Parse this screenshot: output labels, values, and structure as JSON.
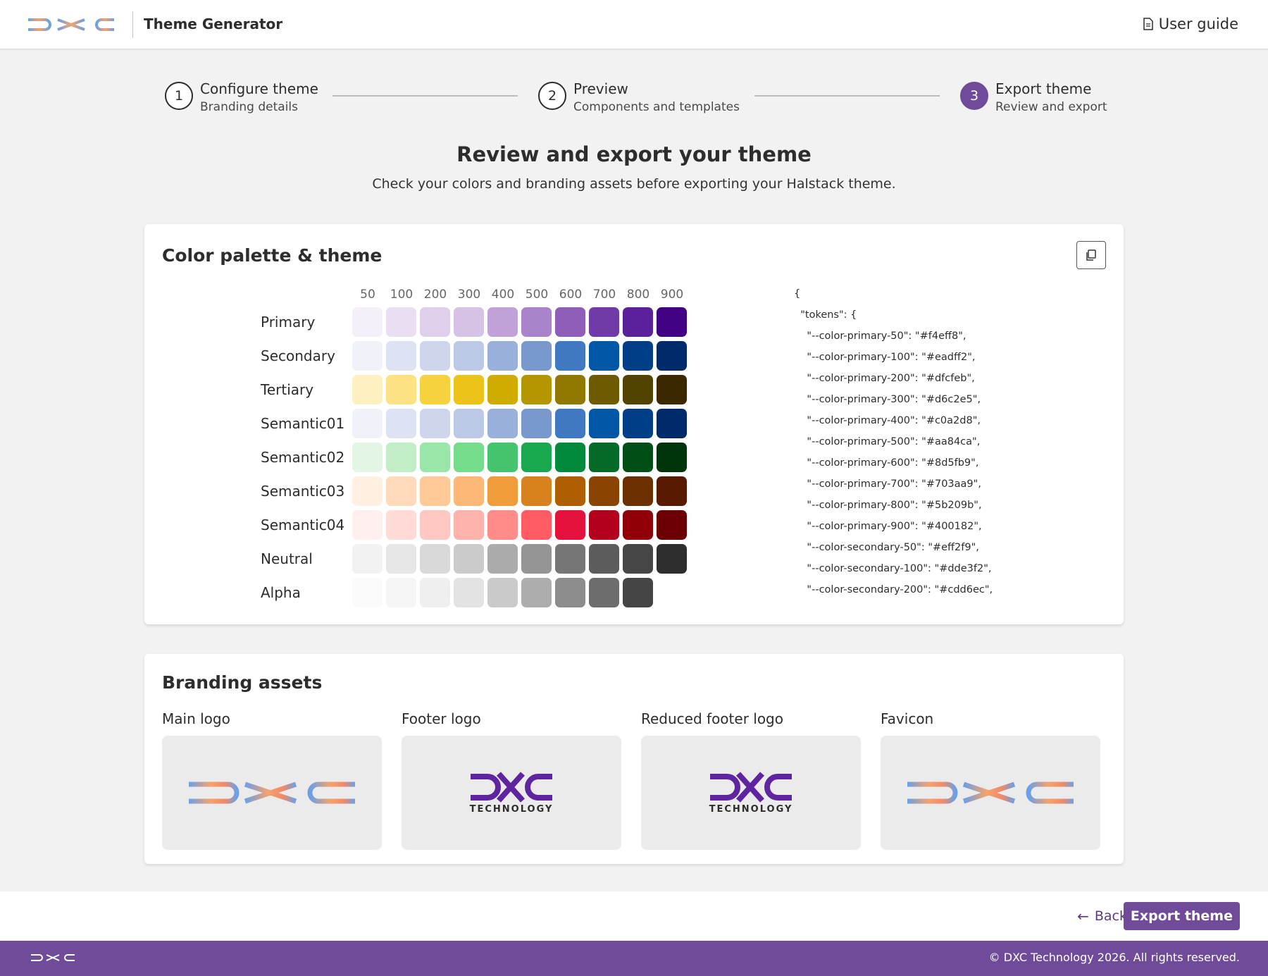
{
  "header": {
    "app_title": "Theme Generator",
    "user_guide_label": "User guide"
  },
  "stepper": [
    {
      "number": "1",
      "title": "Configure theme",
      "subtitle": "Branding details",
      "state": "done"
    },
    {
      "number": "2",
      "title": "Preview",
      "subtitle": "Components and templates",
      "state": "done"
    },
    {
      "number": "3",
      "title": "Export theme",
      "subtitle": "Review and export",
      "state": "active"
    }
  ],
  "page": {
    "title": "Review and export your theme",
    "subtitle": "Check your colors and branding assets before exporting your Halstack theme."
  },
  "palette_card": {
    "title": "Color palette & theme",
    "shades": [
      "50",
      "100",
      "200",
      "300",
      "400",
      "500",
      "600",
      "700",
      "800",
      "900"
    ],
    "rows": [
      {
        "label": "Primary",
        "colors": [
          "#f4eff8",
          "#eadff2",
          "#dfcfeb",
          "#d6c2e5",
          "#c0a2d8",
          "#aa84ca",
          "#8d5fb9",
          "#703aa9",
          "#5b209b",
          "#400182"
        ]
      },
      {
        "label": "Secondary",
        "colors": [
          "#eff2f9",
          "#dde3f2",
          "#cdd6ec",
          "#bbc9e6",
          "#99b0db",
          "#7998cc",
          "#3f79c1",
          "#0057a5",
          "#003f88",
          "#012a6b"
        ]
      },
      {
        "label": "Tertiary",
        "colors": [
          "#fff0c2",
          "#fde283",
          "#f7d23f",
          "#ecc419",
          "#d1ac00",
          "#b59500",
          "#917800",
          "#6e5a00",
          "#534300",
          "#3b2800"
        ]
      },
      {
        "label": "Semantic01",
        "colors": [
          "#eff2f9",
          "#dde3f2",
          "#cdd6ec",
          "#bbc9e6",
          "#99b0db",
          "#7998cc",
          "#3f79c1",
          "#0057a5",
          "#003f88",
          "#012a6b"
        ]
      },
      {
        "label": "Semantic02",
        "colors": [
          "#e3f5e5",
          "#c1edc7",
          "#9ae6a8",
          "#75dc8c",
          "#44c46d",
          "#19a84f",
          "#018a3b",
          "#036b27",
          "#004f17",
          "#00350c"
        ]
      },
      {
        "label": "Semantic03",
        "colors": [
          "#fff0e2",
          "#ffdbbb",
          "#ffca97",
          "#fdb878",
          "#f19c3a",
          "#d8821f",
          "#b05f00",
          "#8a4400",
          "#6c3000",
          "#581a00"
        ]
      },
      {
        "label": "Semantic04",
        "colors": [
          "#fff0ef",
          "#ffdad7",
          "#ffc8c3",
          "#ffb1ab",
          "#ff8c88",
          "#ff5c63",
          "#e5113d",
          "#b3001d",
          "#8f0009",
          "#6b0004"
        ]
      },
      {
        "label": "Neutral",
        "colors": [
          "#f2f2f2",
          "#e6e6e6",
          "#d9d9d9",
          "#cbcbcb",
          "#ababab",
          "#959595",
          "#767676",
          "#5c5c5c",
          "#464646",
          "#2e2e2e"
        ]
      },
      {
        "label": "Alpha",
        "colors": [
          "#fafafa",
          "#f5f5f5",
          "#efefef",
          "#e3e3e3",
          "#cacaca",
          "#adadad",
          "#8c8c8c",
          "#6d6d6d",
          "#454545"
        ]
      }
    ],
    "json_lines": [
      "{",
      "  \"tokens\": {",
      "    \"--color-primary-50\": \"#f4eff8\",",
      "    \"--color-primary-100\": \"#eadff2\",",
      "    \"--color-primary-200\": \"#dfcfeb\",",
      "    \"--color-primary-300\": \"#d6c2e5\",",
      "    \"--color-primary-400\": \"#c0a2d8\",",
      "    \"--color-primary-500\": \"#aa84ca\",",
      "    \"--color-primary-600\": \"#8d5fb9\",",
      "    \"--color-primary-700\": \"#703aa9\",",
      "    \"--color-primary-800\": \"#5b209b\",",
      "    \"--color-primary-900\": \"#400182\",",
      "    \"--color-secondary-50\": \"#eff2f9\",",
      "    \"--color-secondary-100\": \"#dde3f2\",",
      "    \"--color-secondary-200\": \"#cdd6ec\","
    ]
  },
  "branding_card": {
    "title": "Branding assets",
    "assets": [
      {
        "label": "Main logo",
        "logo": "dxc-gradient-logo"
      },
      {
        "label": "Footer logo",
        "logo": "dxc-technology-purple-logo",
        "logo_text": "TECHNOLOGY"
      },
      {
        "label": "Reduced footer logo",
        "logo": "dxc-technology-purple-logo",
        "logo_text": "TECHNOLOGY"
      },
      {
        "label": "Favicon",
        "logo": "dxc-gradient-logo"
      }
    ]
  },
  "actions": {
    "back_label": "Back",
    "export_label": "Export theme"
  },
  "footer": {
    "copyright": "© DXC Technology 2026. All rights reserved."
  },
  "colors": {
    "brand_purple": "#6f4b9a",
    "logo_purple": "#5f249f",
    "gradient_blue": "#6aa0e6",
    "gradient_orange": "#f6a26b"
  }
}
